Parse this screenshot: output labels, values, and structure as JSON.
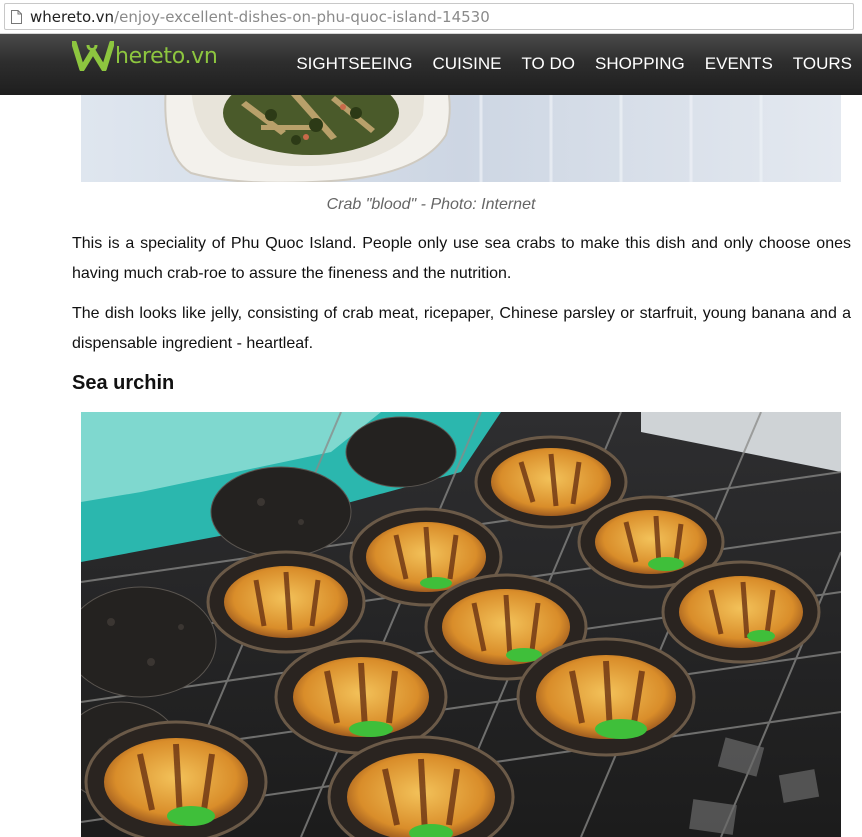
{
  "browser": {
    "url_domain": "whereto.vn",
    "url_path": "/enjoy-excellent-dishes-on-phu-quoc-island-14530"
  },
  "site": {
    "logo_text": "hereto.vn",
    "logo_color": "#8dc63f",
    "nav": [
      "SIGHTSEEING",
      "CUISINE",
      "TO DO",
      "SHOPPING",
      "EVENTS",
      "TOURS"
    ]
  },
  "article": {
    "caption": "Crab \"blood\" - Photo: Internet",
    "paragraphs": [
      "This is a speciality of Phu Quoc Island. People only use sea crabs to make this dish and only choose ones having much crab-roe to assure the fineness and the nutrition.",
      "The dish looks like jelly, consisting of  crab meat, ricepaper, Chinese parsley or starfruit, young banana and a dispensable ingredient - heartleaf."
    ],
    "heading": "Sea urchin"
  }
}
